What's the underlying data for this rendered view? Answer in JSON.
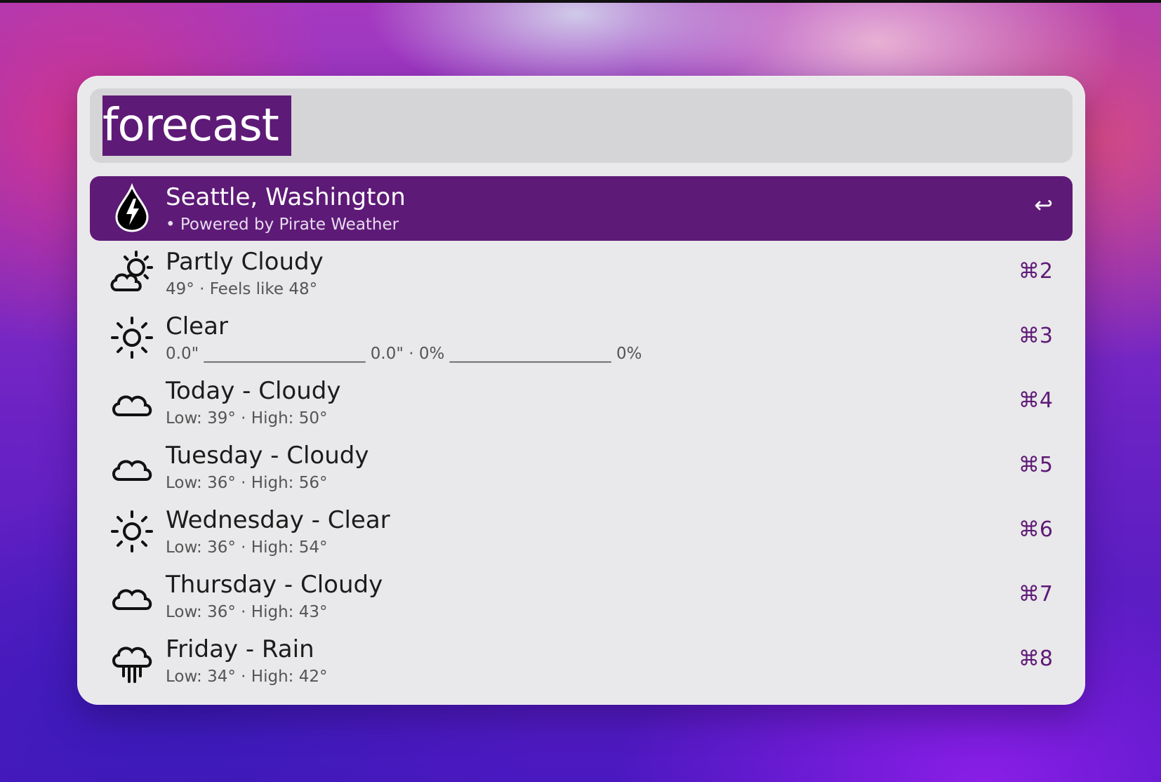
{
  "search": {
    "query": "forecast"
  },
  "results": [
    {
      "title": "Seattle, Washington",
      "subtitle": "• Powered by Pirate Weather",
      "shortcut": "↩",
      "icon": "pirate-weather-drop-icon"
    },
    {
      "title": "Partly Cloudy",
      "subtitle": "49° · Feels like 48°",
      "shortcut": "⌘2",
      "icon": "partly-cloudy-icon"
    },
    {
      "title": "Clear",
      "subtitle": "0.0\" ____________________ 0.0\" · 0% ____________________ 0%",
      "shortcut": "⌘3",
      "icon": "sun-icon"
    },
    {
      "title": "Today - Cloudy",
      "subtitle": "Low: 39° · High: 50°",
      "shortcut": "⌘4",
      "icon": "cloud-icon"
    },
    {
      "title": "Tuesday - Cloudy",
      "subtitle": "Low: 36° · High: 56°",
      "shortcut": "⌘5",
      "icon": "cloud-icon"
    },
    {
      "title": "Wednesday - Clear",
      "subtitle": "Low: 36° · High: 54°",
      "shortcut": "⌘6",
      "icon": "sun-icon"
    },
    {
      "title": "Thursday - Cloudy",
      "subtitle": "Low: 36° · High: 43°",
      "shortcut": "⌘7",
      "icon": "cloud-icon"
    },
    {
      "title": "Friday - Rain",
      "subtitle": "Low: 34° · High: 42°",
      "shortcut": "⌘8",
      "icon": "rain-icon"
    }
  ],
  "colors": {
    "accent": "#5e1a77",
    "panel": "#e9e8ea",
    "search_bar": "#d5d4d7"
  }
}
